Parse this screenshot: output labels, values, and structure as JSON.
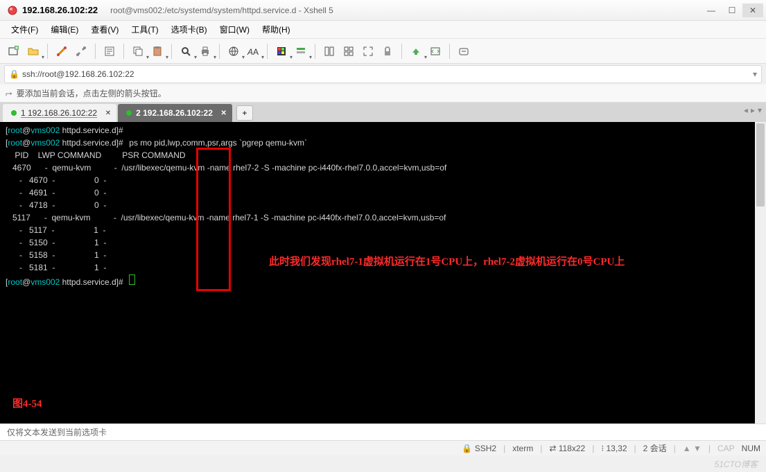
{
  "window": {
    "title_host": "192.168.26.102:22",
    "title_path": "root@vms002:/etc/systemd/system/httpd.service.d - Xshell 5"
  },
  "menu": {
    "file": "文件(F)",
    "edit": "编辑(E)",
    "view": "查看(V)",
    "tools": "工具(T)",
    "tab": "选项卡(B)",
    "window": "窗口(W)",
    "help": "帮助(H)"
  },
  "address": {
    "url": "ssh://root@192.168.26.102:22"
  },
  "hint": {
    "text": "要添加当前会话，点击左侧的箭头按钮。"
  },
  "tabs": {
    "t1": "1 192.168.26.102:22",
    "t2": "2 192.168.26.102:22"
  },
  "terminal": {
    "prompt_user": "root",
    "prompt_host": "vms002",
    "prompt_dir": "httpd.service.d",
    "cmd": "ps mo pid,lwp,comm,psr,args `pgrep qemu-kvm`",
    "header": "    PID    LWP COMMAND         PSR COMMAND",
    "rows": [
      {
        "pid": "   4670",
        "lwp": "     -",
        "comm": " qemu-kvm       ",
        "psr": "  -",
        "args": " /usr/libexec/qemu-kvm -name rhel7-2 -S -machine pc-i440fx-rhel7.0.0,accel=kvm,usb=of"
      },
      {
        "pid": "      -",
        "lwp": "  4670",
        "comm": " -              ",
        "psr": "  0",
        "args": " -"
      },
      {
        "pid": "      -",
        "lwp": "  4691",
        "comm": " -              ",
        "psr": "  0",
        "args": " -"
      },
      {
        "pid": "      -",
        "lwp": "  4718",
        "comm": " -              ",
        "psr": "  0",
        "args": " -"
      },
      {
        "pid": "   5117",
        "lwp": "     -",
        "comm": " qemu-kvm       ",
        "psr": "  -",
        "args": " /usr/libexec/qemu-kvm -name rhel7-1 -S -machine pc-i440fx-rhel7.0.0,accel=kvm,usb=of"
      },
      {
        "pid": "      -",
        "lwp": "  5117",
        "comm": " -              ",
        "psr": "  1",
        "args": " -"
      },
      {
        "pid": "      -",
        "lwp": "  5150",
        "comm": " -              ",
        "psr": "  1",
        "args": " -"
      },
      {
        "pid": "      -",
        "lwp": "  5158",
        "comm": " -              ",
        "psr": "  1",
        "args": " -"
      },
      {
        "pid": "      -",
        "lwp": "  5181",
        "comm": " -              ",
        "psr": "  1",
        "args": " -"
      }
    ],
    "annotation": "此时我们发现rhel7-1虚拟机运行在1号CPU上，rhel7-2虚拟机运行在0号CPU上",
    "figure_label": "图4-54"
  },
  "bottom": {
    "send_hint": "仅将文本发送到当前选项卡"
  },
  "status": {
    "proto": "SSH2",
    "term": "xterm",
    "size": "118x22",
    "pos": "13,32",
    "sessions": "2 会话",
    "cap": "CAP",
    "num": "NUM"
  },
  "watermark": "51CTO博客",
  "chart_data": {
    "type": "table",
    "title": "ps mo pid,lwp,comm,psr,args `pgrep qemu-kvm`",
    "columns": [
      "PID",
      "LWP",
      "COMMAND",
      "PSR",
      "COMMAND_ARGS"
    ],
    "rows": [
      [
        4670,
        null,
        "qemu-kvm",
        null,
        "/usr/libexec/qemu-kvm -name rhel7-2 -S -machine pc-i440fx-rhel7.0.0,accel=kvm,usb=of"
      ],
      [
        null,
        4670,
        null,
        0,
        null
      ],
      [
        null,
        4691,
        null,
        0,
        null
      ],
      [
        null,
        4718,
        null,
        0,
        null
      ],
      [
        5117,
        null,
        "qemu-kvm",
        null,
        "/usr/libexec/qemu-kvm -name rhel7-1 -S -machine pc-i440fx-rhel7.0.0,accel=kvm,usb=of"
      ],
      [
        null,
        5117,
        null,
        1,
        null
      ],
      [
        null,
        5150,
        null,
        1,
        null
      ],
      [
        null,
        5158,
        null,
        1,
        null
      ],
      [
        null,
        5181,
        null,
        1,
        null
      ]
    ]
  }
}
